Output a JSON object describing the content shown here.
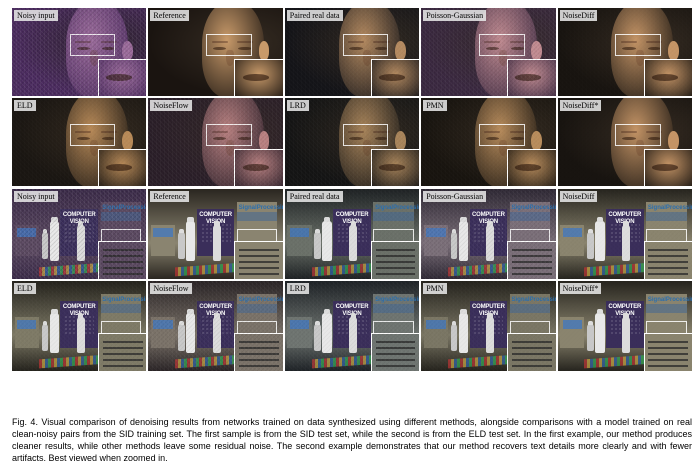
{
  "figure": {
    "rows": [
      {
        "scene": "face",
        "panels": [
          {
            "label": "Noisy input",
            "tone": {
              "bg": "#4a2a5e",
              "skin": "#9a6a9a",
              "noise": 0.9
            }
          },
          {
            "label": "Reference",
            "tone": {
              "bg": "#1a1410",
              "skin": "#c89a6a",
              "noise": 0
            }
          },
          {
            "label": "Paired real data",
            "tone": {
              "bg": "#141418",
              "skin": "#b48a60",
              "noise": 0.25
            }
          },
          {
            "label": "Poisson-Gaussian",
            "tone": {
              "bg": "#3a2840",
              "skin": "#c08a90",
              "noise": 0.55
            }
          },
          {
            "label": "NoiseDiff",
            "tone": {
              "bg": "#181410",
              "skin": "#c49466",
              "noise": 0.1
            }
          }
        ]
      },
      {
        "scene": "face",
        "panels": [
          {
            "label": "ELD",
            "tone": {
              "bg": "#1a1612",
              "skin": "#b88a58",
              "noise": 0.2
            }
          },
          {
            "label": "NoiseFlow",
            "tone": {
              "bg": "#2a1e28",
              "skin": "#b88080",
              "noise": 0.5
            }
          },
          {
            "label": "LRD",
            "tone": {
              "bg": "#141414",
              "skin": "#a8845a",
              "noise": 0.3
            }
          },
          {
            "label": "PMN",
            "tone": {
              "bg": "#18140f",
              "skin": "#b88c5c",
              "noise": 0.2
            }
          },
          {
            "label": "NoiseDiff*",
            "tone": {
              "bg": "#181410",
              "skin": "#c49466",
              "noise": 0.05
            }
          }
        ]
      },
      {
        "scene": "objects",
        "panels": [
          {
            "label": "Noisy input",
            "tone": {
              "bg": "#3a2a48",
              "shelf": "#5a4860",
              "noise": 0.9
            }
          },
          {
            "label": "Reference",
            "tone": {
              "bg": "#2a2620",
              "shelf": "#8a8470",
              "noise": 0
            }
          },
          {
            "label": "Paired real data",
            "tone": {
              "bg": "#1e2224",
              "shelf": "#6a7068",
              "noise": 0.25
            }
          },
          {
            "label": "Poisson-Gaussian",
            "tone": {
              "bg": "#2e2834",
              "shelf": "#7a6e78",
              "noise": 0.5
            }
          },
          {
            "label": "NoiseDiff",
            "tone": {
              "bg": "#26241e",
              "shelf": "#8a846e",
              "noise": 0.1
            }
          }
        ]
      },
      {
        "scene": "objects",
        "panels": [
          {
            "label": "ELD",
            "tone": {
              "bg": "#24221c",
              "shelf": "#7e7a66",
              "noise": 0.25
            }
          },
          {
            "label": "NoiseFlow",
            "tone": {
              "bg": "#2a2426",
              "shelf": "#7a7268",
              "noise": 0.45
            }
          },
          {
            "label": "LRD",
            "tone": {
              "bg": "#1e2226",
              "shelf": "#6e7470",
              "noise": 0.3
            }
          },
          {
            "label": "PMN",
            "tone": {
              "bg": "#24221c",
              "shelf": "#7a7664",
              "noise": 0.2
            }
          },
          {
            "label": "NoiseDiff*",
            "tone": {
              "bg": "#26241e",
              "shelf": "#8a846e",
              "noise": 0.05
            }
          }
        ]
      }
    ],
    "book_title": "COMPUTER VISION",
    "book_sub": "ALGORITHMS",
    "signal_title": "SignalProcessing"
  },
  "caption": "Fig. 4. Visual comparison of denoising results from networks trained on data synthesized using different methods, alongside comparisons with a model trained on real clean-noisy pairs from the SID training set. The first sample is from the SID test set, while the second is from the ELD test set. In the first example, our method produces cleaner results, while other methods leave some residual noise. The second example demonstrates that our method recovers text details more clearly and with fewer artifacts. Best viewed when zoomed in."
}
